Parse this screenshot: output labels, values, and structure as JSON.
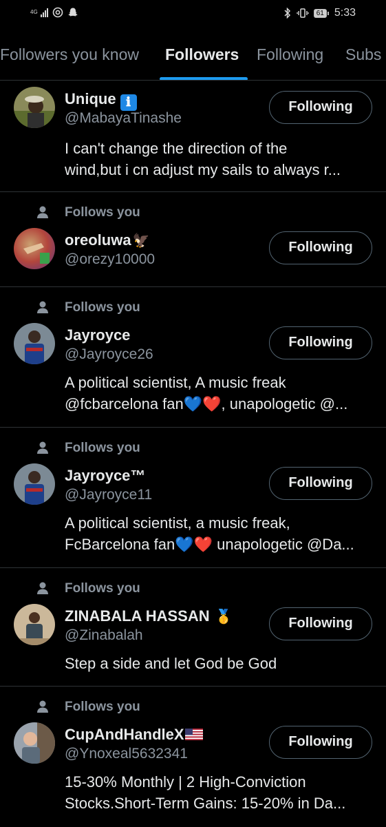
{
  "status_bar": {
    "network": "4G",
    "battery": "61",
    "time": "5:33"
  },
  "tabs": [
    {
      "label": "Followers you know"
    },
    {
      "label": "Followers"
    },
    {
      "label": "Following"
    },
    {
      "label": "Subs"
    }
  ],
  "accent_color": "#1d9bf0",
  "followers": [
    {
      "follows_you": "",
      "name": "Unique",
      "badge": "ℹ",
      "handle": "@MabayaTinashe",
      "button": "Following",
      "bio": [
        "I can't change the direction of the",
        "wind,but i cn adjust my sails to always r..."
      ]
    },
    {
      "follows_you": "Follows you",
      "name": "oreoluwa",
      "badge": "🦅",
      "handle": "@orezy10000",
      "button": "Following",
      "bio": []
    },
    {
      "follows_you": "Follows you",
      "name": "Jayroyce",
      "badge": "",
      "handle": "@Jayroyce26",
      "button": "Following",
      "bio": [
        "A political scientist, A music freak",
        "@fcbarcelona fan💙❤️, unapologetic @..."
      ]
    },
    {
      "follows_you": "Follows you",
      "name": "Jayroyce™",
      "badge": "",
      "handle": "@Jayroyce11",
      "button": "Following",
      "bio": [
        "A political scientist, a music freak,",
        "FcBarcelona fan💙❤️ unapologetic @Da..."
      ]
    },
    {
      "follows_you": "Follows you",
      "name": "ZINABALA HASSAN",
      "badge": "🥇",
      "handle": "@Zinabalah",
      "button": "Following",
      "bio": [
        "Step a side and let God be God"
      ]
    },
    {
      "follows_you": "Follows you",
      "name": "CupAndHandleX",
      "badge": "us-flag",
      "handle": "@Ynoxeal5632341",
      "button": "Following",
      "bio": [
        "15-30% Monthly | 2 High-Conviction",
        "Stocks.Short-Term Gains: 15-20% in Da..."
      ]
    }
  ]
}
